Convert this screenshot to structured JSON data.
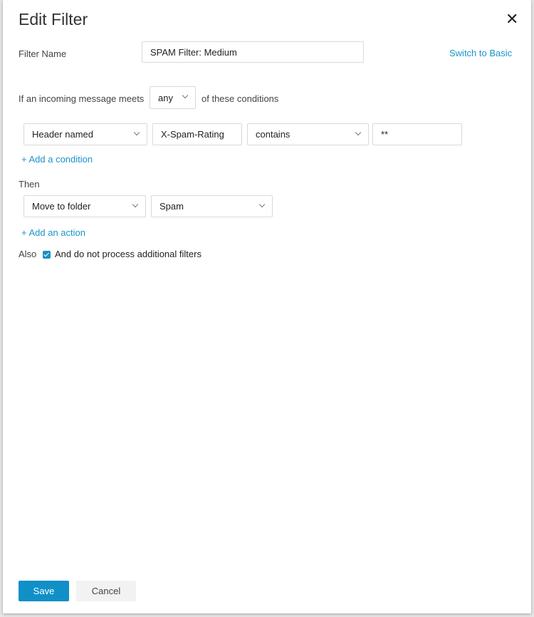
{
  "dialog": {
    "title": "Edit Filter",
    "close_icon": "close-icon"
  },
  "filter_name": {
    "label": "Filter Name",
    "value": "SPAM Filter: Medium"
  },
  "switch_link": "Switch to Basic",
  "conditions": {
    "prefix": "If an incoming message meets",
    "match": "any",
    "suffix": "of these conditions",
    "rows": [
      {
        "field": "Header named",
        "header": "X-Spam-Rating",
        "operator": "contains",
        "value": "**"
      }
    ],
    "add": "+ Add a condition"
  },
  "then": {
    "label": "Then",
    "action": "Move to folder",
    "folder": "Spam",
    "add": "+ Add an action"
  },
  "also": {
    "label": "Also",
    "checkbox_label": "And do not process additional filters",
    "checked": true
  },
  "buttons": {
    "save": "Save",
    "cancel": "Cancel"
  },
  "colors": {
    "accent": "#1190c8"
  }
}
